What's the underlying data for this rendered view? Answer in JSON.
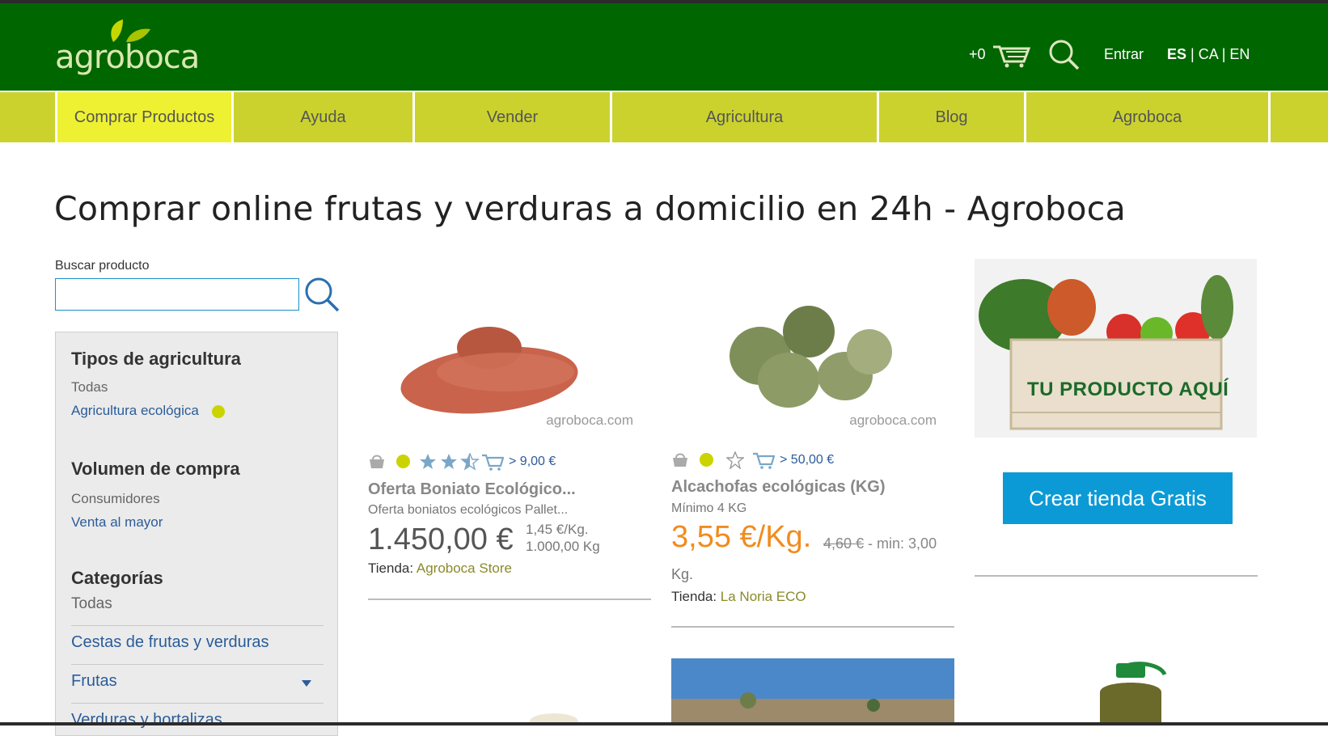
{
  "header": {
    "logo_text": "agroboca",
    "cart_count": "+0",
    "login": "Entrar",
    "lang_es": "ES",
    "lang_ca": " | CA | EN",
    "colors": {
      "header_bg": "#006600",
      "nav_bg": "#cbd22e",
      "nav_active": "#eef132"
    }
  },
  "nav": {
    "items": [
      "Comprar Productos",
      "Ayuda",
      "Vender",
      "Agricultura",
      "Blog",
      "Agroboca"
    ]
  },
  "page": {
    "title": "Comprar online frutas y verduras a domicilio en 24h - Agroboca"
  },
  "search": {
    "label": "Buscar producto",
    "value": "",
    "placeholder": ""
  },
  "sidebar": {
    "agri_heading": "Tipos de agricultura",
    "agri_all": "Todas",
    "agri_eco": "Agricultura ecológica",
    "volume_heading": "Volumen de compra",
    "volume_consumers": "Consumidores",
    "volume_wholesale": "Venta al mayor",
    "cat_heading": "Categorías",
    "cat_all": "Todas",
    "cat_baskets": "Cestas de frutas y verduras",
    "cat_fruits": "Frutas",
    "cat_vegetables": "Verduras y hortalizas"
  },
  "products": [
    {
      "min_order": "> 9,00 €",
      "rating": 3.5,
      "title": "Oferta Boniato Ecológico...",
      "subtitle": "Oferta boniatos ecológicos Pallet...",
      "price": "1.450,00 €",
      "unit_price": "1,45 €/Kg.",
      "quantity": "1.000,00 Kg",
      "store_label": "Tienda: ",
      "store": "Agroboca Store",
      "watermark": "agroboca.com"
    },
    {
      "min_order": "> 50,00 €",
      "rating": 0,
      "title": "Alcachofas ecológicas (KG)",
      "subtitle": "Mínimo 4 KG",
      "price": "3,55 €/Kg.",
      "old_price": "4,60 €",
      "min_text": " - min: 3,00",
      "min_unit": "Kg.",
      "store_label": "Tienda: ",
      "store": "La Noria ECO",
      "watermark": "agroboca.com"
    }
  ],
  "ad": {
    "banner_text": "TU PRODUCTO AQUÍ",
    "cta": "Crear tienda Gratis"
  },
  "icons": [
    "leaf-logo-icon",
    "cart-icon",
    "search-icon",
    "basket-icon",
    "eco-dot-icon",
    "star-icon",
    "truck-cart-icon",
    "caret-down-icon"
  ]
}
